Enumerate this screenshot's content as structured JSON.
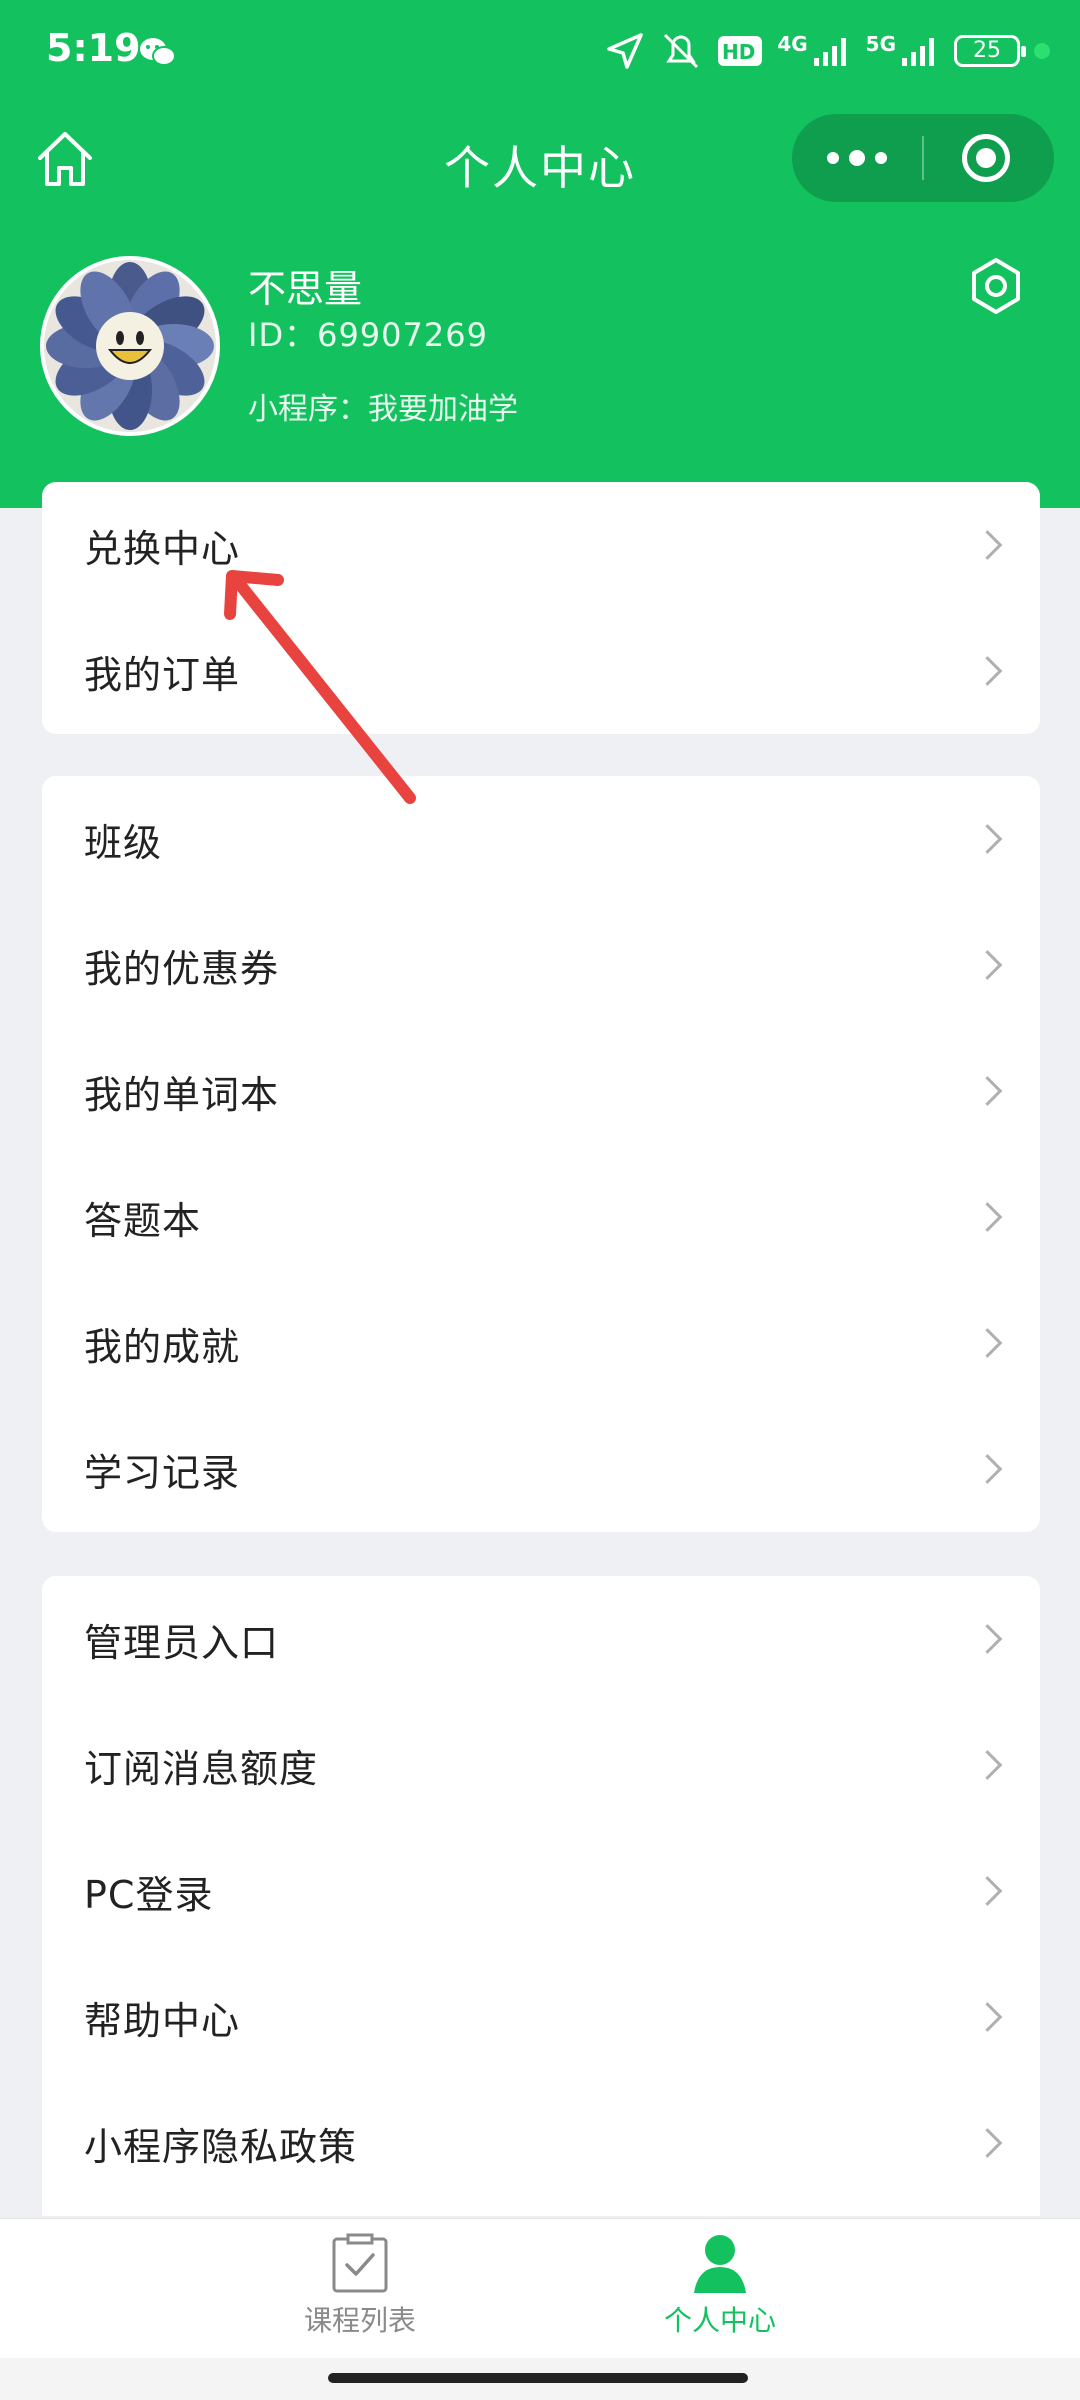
{
  "status_bar": {
    "time": "5:19",
    "network_1": "4G",
    "network_2": "5G",
    "battery": "25"
  },
  "nav": {
    "title": "个人中心"
  },
  "profile": {
    "name": "不思量",
    "id": "ID：69907269",
    "mini_program": "小程序：我要加油学"
  },
  "card1": [
    {
      "label": "兑换中心"
    },
    {
      "label": "我的订单"
    }
  ],
  "card2": [
    {
      "label": "班级"
    },
    {
      "label": "我的优惠券"
    },
    {
      "label": "我的单词本"
    },
    {
      "label": "答题本"
    },
    {
      "label": "我的成就"
    },
    {
      "label": "学习记录"
    }
  ],
  "card3": [
    {
      "label": "管理员入口"
    },
    {
      "label": "订阅消息额度"
    },
    {
      "label": "PC登录"
    },
    {
      "label": "帮助中心"
    },
    {
      "label": "小程序隐私政策"
    }
  ],
  "tabs": [
    {
      "label": "课程列表"
    },
    {
      "label": "个人中心"
    }
  ],
  "colors": {
    "brand_green": "#13c25f",
    "annotation_red": "#e8433f",
    "page_bg": "#eef0f3"
  }
}
